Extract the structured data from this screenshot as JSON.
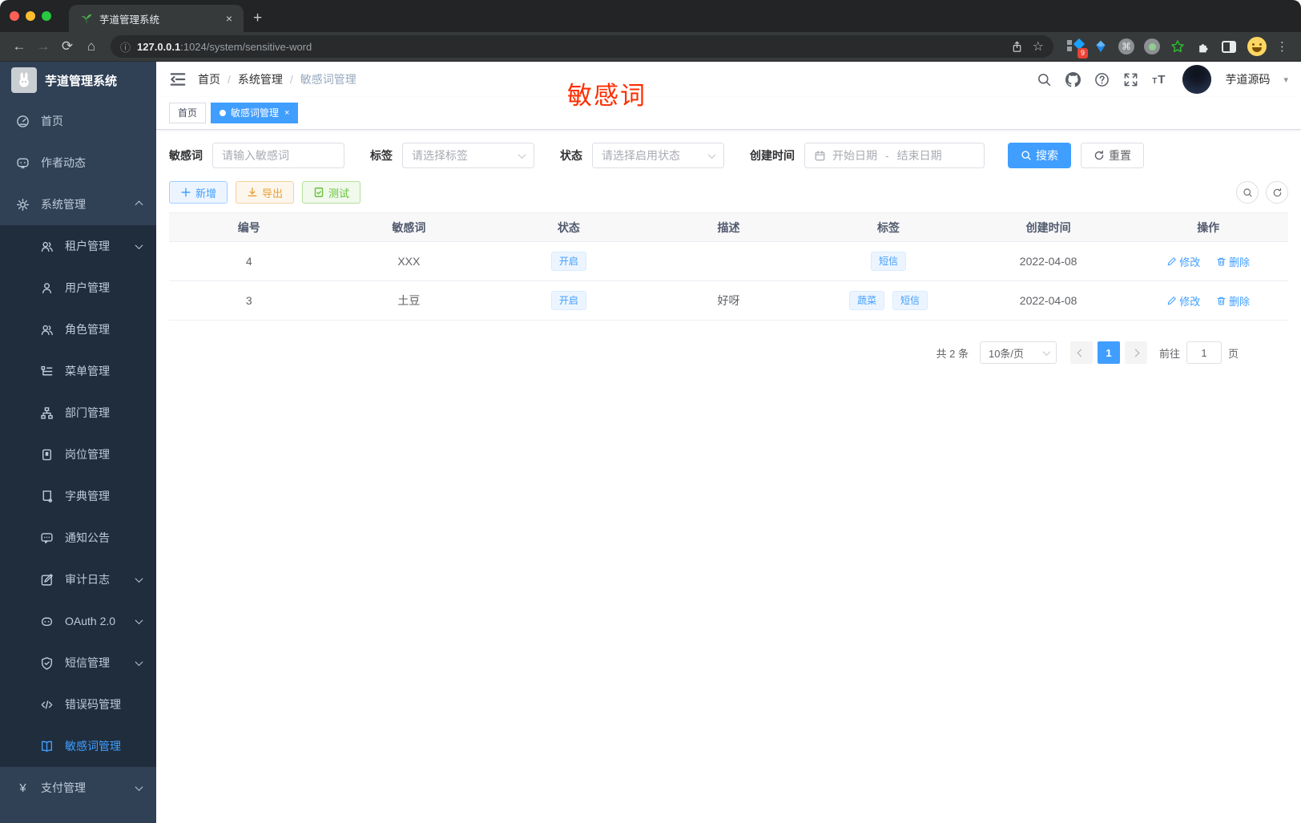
{
  "annotation": {
    "text": "敏感词"
  },
  "colors": {
    "primary": "#409eff",
    "warning": "#e6a23c",
    "success": "#67c23a",
    "annotation_red": "#ff2d00",
    "sidebar_bg": "#304156",
    "submenu_bg": "#1f2d3d"
  },
  "glyphs": {
    "close": "×",
    "plus": "+",
    "back": "←",
    "forward": "→",
    "reload": "⟳",
    "home": "⌂",
    "dots": "⋮",
    "caret": "▾",
    "command": "⌘",
    "star": "☆",
    "info": "ⓘ"
  },
  "browser": {
    "tab_title": "芋道管理系统",
    "url_host": "127.0.0.1",
    "url_rest": ":1024/system/sensitive-word",
    "extension_badge": "9"
  },
  "topbar": {
    "breadcrumb": [
      "首页",
      "系统管理",
      "敏感词管理"
    ],
    "separator": "/",
    "username": "芋道源码"
  },
  "sidebar": {
    "app_title": "芋道管理系统",
    "items": [
      {
        "label": "首页"
      },
      {
        "label": "作者动态"
      },
      {
        "label": "系统管理"
      },
      {
        "label": "租户管理"
      },
      {
        "label": "用户管理"
      },
      {
        "label": "角色管理"
      },
      {
        "label": "菜单管理"
      },
      {
        "label": "部门管理"
      },
      {
        "label": "岗位管理"
      },
      {
        "label": "字典管理"
      },
      {
        "label": "通知公告"
      },
      {
        "label": "审计日志"
      },
      {
        "label": "OAuth 2.0"
      },
      {
        "label": "短信管理"
      },
      {
        "label": "错误码管理"
      },
      {
        "label": "敏感词管理"
      },
      {
        "label": "支付管理"
      }
    ],
    "pay_icon_glyph": "¥"
  },
  "tabs": [
    {
      "label": "首页"
    },
    {
      "label": "敏感词管理"
    }
  ],
  "filters": {
    "keyword_label": "敏感词",
    "keyword_placeholder": "请输入敏感词",
    "tag_label": "标签",
    "tag_placeholder": "请选择标签",
    "status_label": "状态",
    "status_placeholder": "请选择启用状态",
    "date_label": "创建时间",
    "date_start_placeholder": "开始日期",
    "date_separator": "-",
    "date_end_placeholder": "结束日期",
    "search_label": "搜索",
    "reset_label": "重置"
  },
  "toolbar": {
    "add_label": "新增",
    "export_label": "导出",
    "test_label": "测试"
  },
  "table": {
    "headers": [
      "编号",
      "敏感词",
      "状态",
      "描述",
      "标签",
      "创建时间",
      "操作"
    ],
    "rows": [
      {
        "id": "4",
        "word": "XXX",
        "status": "开启",
        "description": "",
        "tags": [
          "短信"
        ],
        "create_time": "2022-04-08",
        "edit_label": "修改",
        "delete_label": "删除"
      },
      {
        "id": "3",
        "word": "土豆",
        "status": "开启",
        "description": "好呀",
        "tags": [
          "蔬菜",
          "短信"
        ],
        "create_time": "2022-04-08",
        "edit_label": "修改",
        "delete_label": "删除"
      }
    ]
  },
  "pagination": {
    "total_text": "共 2 条",
    "page_size": "10条/页",
    "current_page": "1",
    "goto_label": "前往",
    "goto_value": "1",
    "page_label": "页"
  }
}
